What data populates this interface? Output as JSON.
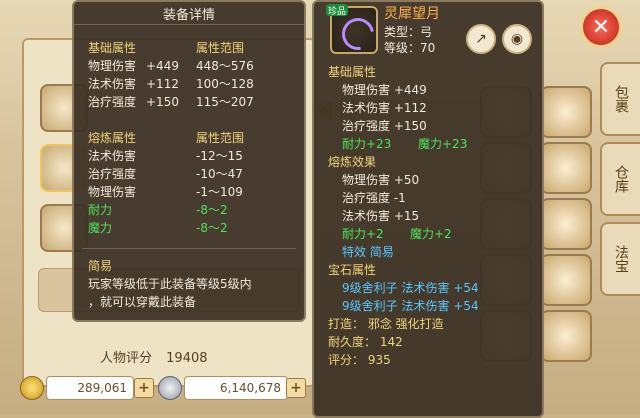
{
  "background": {
    "tab_labels": [
      "包裹",
      "仓库",
      "法宝"
    ],
    "close": "✕",
    "gold_amount": "289,061",
    "silver_amount": "6,140,678",
    "score_label": "人物评分",
    "score_value": "19408"
  },
  "left_tooltip": {
    "title": "装备详情",
    "base": {
      "header_left": "基础属性",
      "header_right": "属性范围",
      "rows": [
        {
          "name": "物理伤害",
          "value": "+449",
          "range": "448～576"
        },
        {
          "name": "法术伤害",
          "value": "+112",
          "range": "100～128"
        },
        {
          "name": "治疗强度",
          "value": "+150",
          "range": "115～207"
        }
      ]
    },
    "refine": {
      "header_left": "熔炼属性",
      "header_right": "属性范围",
      "rows": [
        {
          "name": "法术伤害",
          "range": "-12～15",
          "tone": "white"
        },
        {
          "name": "治疗强度",
          "range": "-10～47",
          "tone": "white"
        },
        {
          "name": "物理伤害",
          "range": "-1～109",
          "tone": "white"
        },
        {
          "name": "耐力",
          "range": "-8～2",
          "tone": "green"
        },
        {
          "name": "魔力",
          "range": "-8～2",
          "tone": "green"
        }
      ]
    },
    "simple_title": "简易",
    "simple_desc_line1": "玩家等级低于此装备等级5级内",
    "simple_desc_line2": "，就可以穿戴此装备"
  },
  "right_tooltip": {
    "badge": "珍品",
    "item_name": "灵犀望月",
    "type_line": "类型：弓",
    "level_line": "等级：70",
    "base_title": "基础属性",
    "base_rows": [
      "物理伤害 +449",
      "法术伤害 +112",
      "治疗强度 +150"
    ],
    "base_green": {
      "left": "耐力+23",
      "right": "魔力+23"
    },
    "refine_title": "熔炼效果",
    "refine_rows": [
      "物理伤害 +50",
      "治疗强度 -1",
      "法术伤害 +15"
    ],
    "refine_green": {
      "left": "耐力+2",
      "right": "魔力+2"
    },
    "special_line": "特效  简易",
    "gem_title": "宝石属性",
    "gem_rows": [
      "9级舍利子  法术伤害  +54",
      "9级舍利子  法术伤害  +54"
    ],
    "forge_line": "打造：  邪念    强化打造",
    "durability_line": "耐久度：  142",
    "score_line": "评分：  935"
  },
  "colors": {
    "tooltip_bg": "#3a2f24",
    "label_yellow": "#f0d57a",
    "value_white": "#f3ead8",
    "green": "#4fe35a",
    "cyan": "#58c7ff",
    "name_orange": "#ffb14a"
  },
  "icons": {
    "close": "close-icon",
    "share": "share-icon",
    "view": "eye-icon",
    "gold": "gold-coin-icon",
    "silver": "silver-coin-icon"
  }
}
